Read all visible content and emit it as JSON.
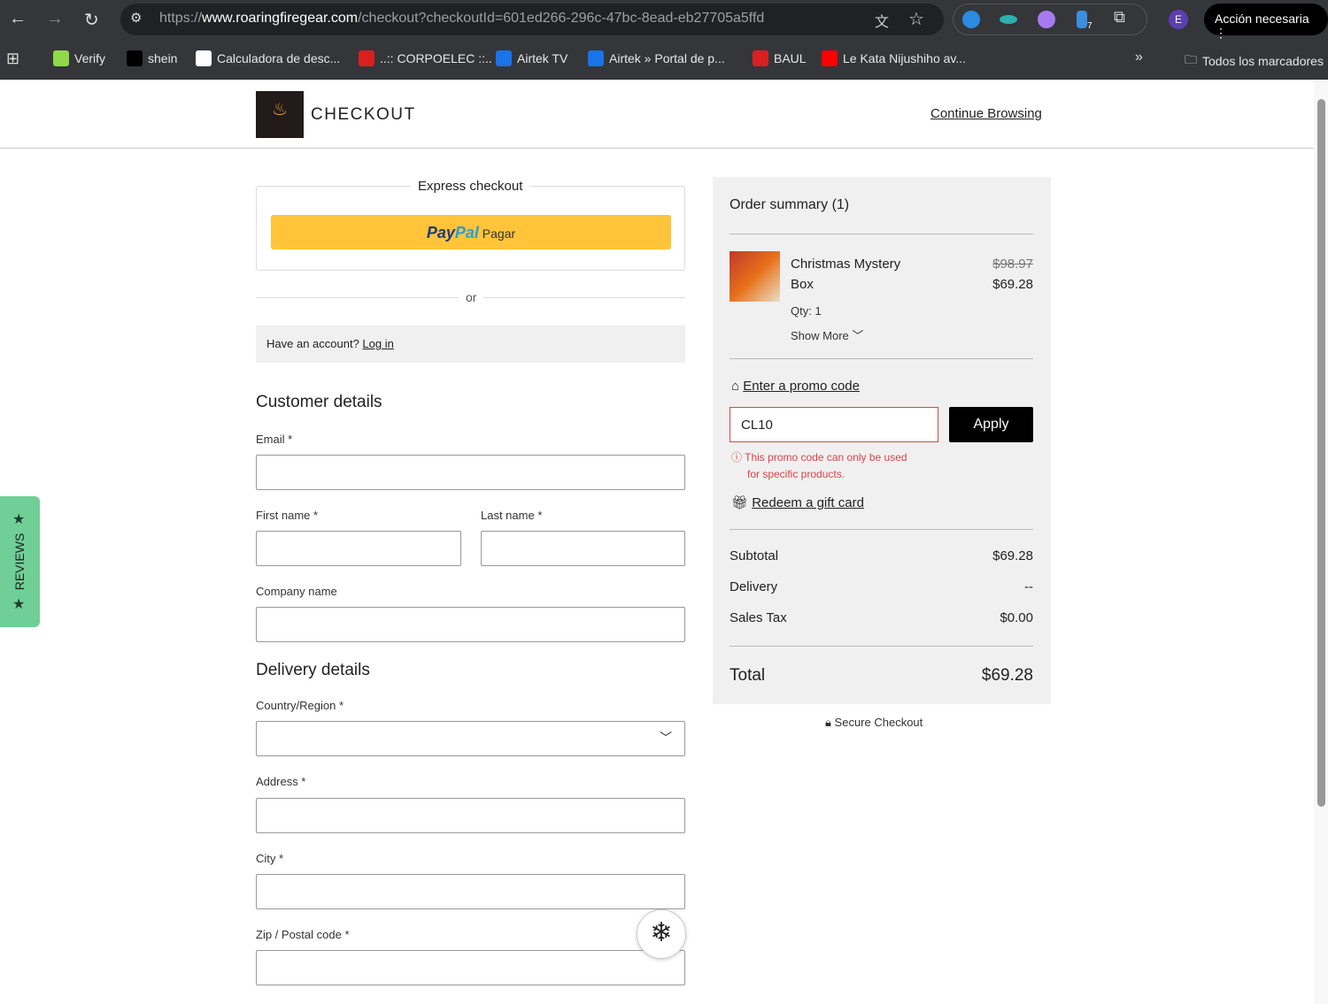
{
  "browser": {
    "url_prefix": "https://",
    "url_domain": "www.roaringfiregear.com",
    "url_path": "/checkout?checkoutId=601ed266-296c-47bc-8ead-eb27705a5ffd",
    "profile_initial": "E",
    "action_label": "Acción necesaria",
    "ext_badge": "7",
    "bookmarks": [
      {
        "label": "Verify",
        "color": "#8fd94a"
      },
      {
        "label": "shein",
        "color": "#000000"
      },
      {
        "label": "Calculadora de desc...",
        "color": "#ffffff"
      },
      {
        "label": "..:: CORPOELEC ::..",
        "color": "#d82020"
      },
      {
        "label": "Airtek TV",
        "color": "#1a73e8"
      },
      {
        "label": "Airtek » Portal de p...",
        "color": "#1a73e8"
      },
      {
        "label": "BAUL",
        "color": "#d82020"
      },
      {
        "label": "Le Kata Nijushiho av...",
        "color": "#ff0000"
      }
    ],
    "all_bookmarks": "Todos los marcadores"
  },
  "header": {
    "title": "CHECKOUT",
    "continue": "Continue Browsing"
  },
  "express": {
    "label": "Express checkout",
    "paypal_a": "Pay",
    "paypal_b": "Pal",
    "paypal_action": "Pagar",
    "or": "or",
    "account_q": "Have an account?",
    "login": "Log in"
  },
  "customer": {
    "title": "Customer details",
    "email": "Email *",
    "first": "First name *",
    "last": "Last name *",
    "company": "Company name"
  },
  "delivery": {
    "title": "Delivery details",
    "country": "Country/Region *",
    "address": "Address *",
    "city": "City *",
    "zip": "Zip / Postal code *"
  },
  "summary": {
    "title": "Order summary (1)",
    "item": {
      "name_l1": "Christmas Mystery",
      "name_l2": "Box",
      "old_price": "$98.97",
      "price": "$69.28",
      "qty": "Qty: 1",
      "show_more": "Show More"
    },
    "promo_link": "Enter a promo code",
    "promo_value": "CL10",
    "apply": "Apply",
    "error_l1": "This promo code can only be used",
    "error_l2": "for specific products.",
    "gift": "Redeem a gift card",
    "rows": [
      {
        "label": "Subtotal",
        "value": "$69.28"
      },
      {
        "label": "Delivery",
        "value": "--"
      },
      {
        "label": "Sales Tax",
        "value": "$0.00"
      }
    ],
    "total_label": "Total",
    "total": "$69.28",
    "secure": "Secure Checkout"
  },
  "reviews": "REVIEWS",
  "colors": {
    "paypal": "#ffc43a",
    "error": "#d9434a",
    "reviews": "#6fcf97"
  }
}
